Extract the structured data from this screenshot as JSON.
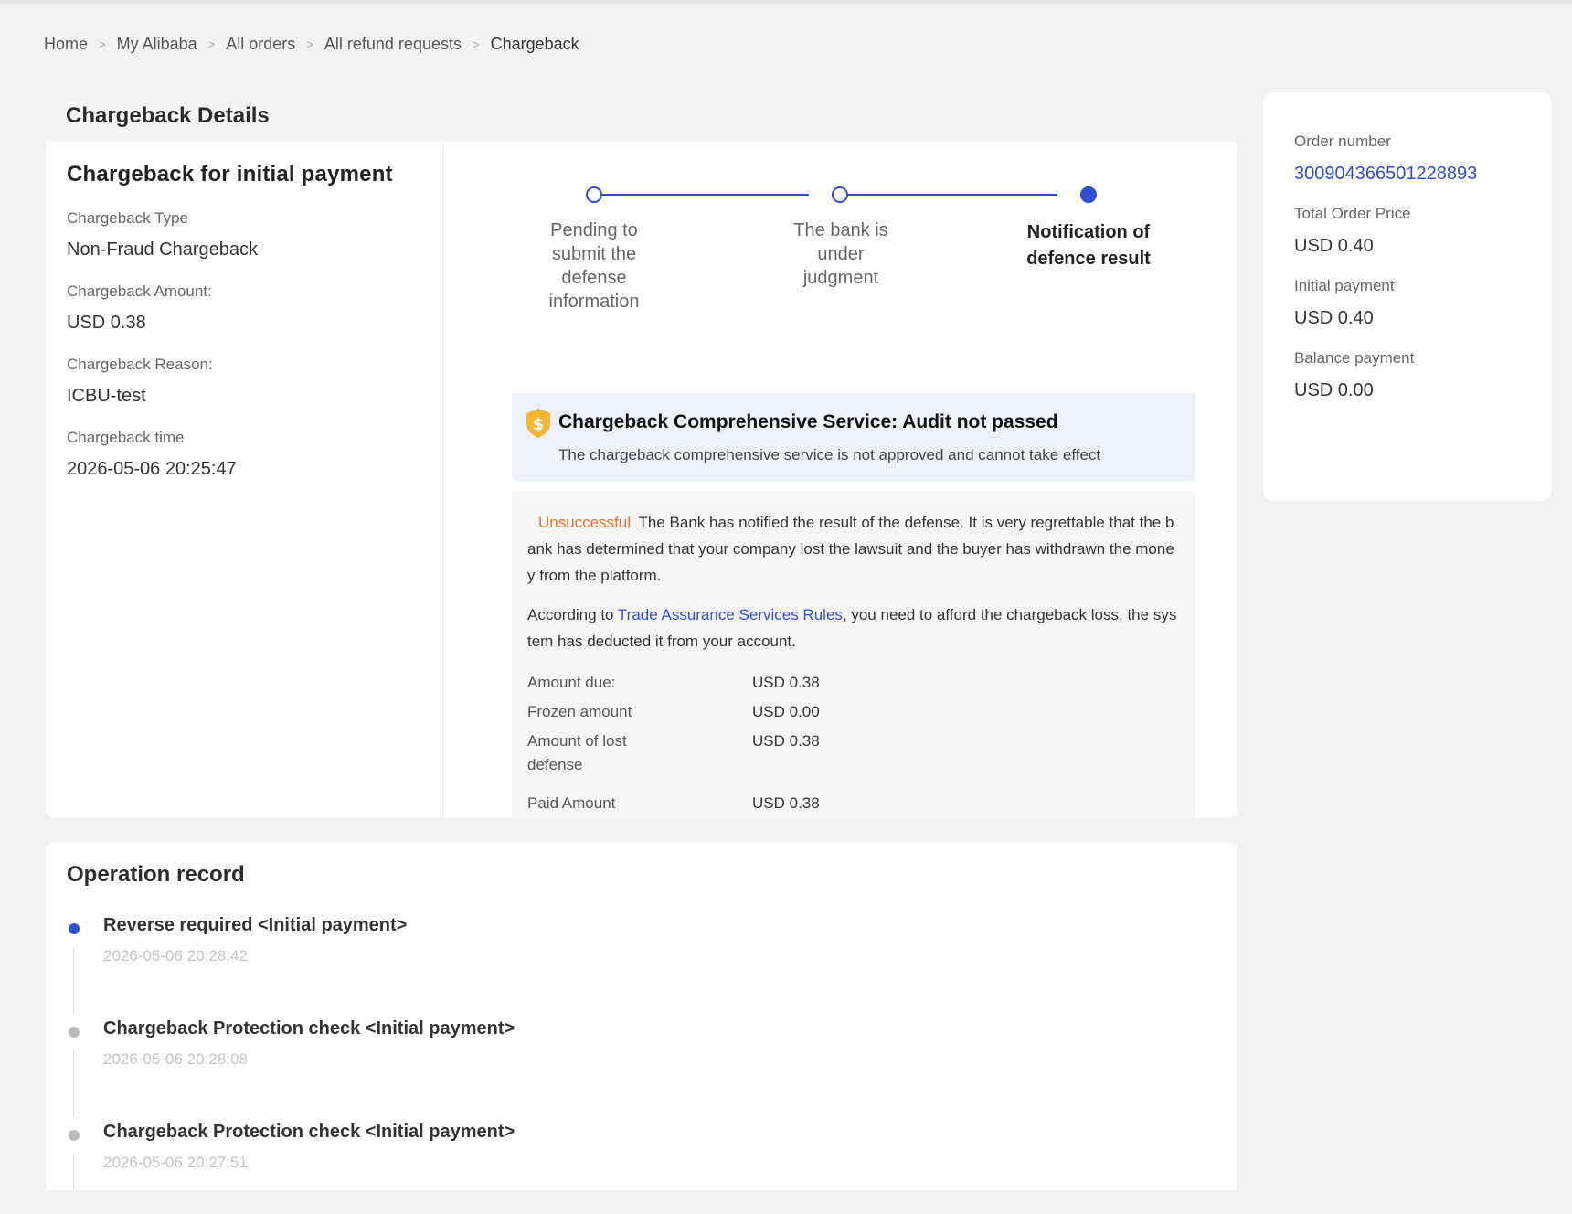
{
  "breadcrumb": {
    "items": [
      "Home",
      "My Alibaba",
      "All orders",
      "All refund requests",
      "Chargeback"
    ],
    "separator": ">"
  },
  "details": {
    "header": "Chargeback Details",
    "subtitle": "Chargeback for initial payment",
    "fields": [
      {
        "label": "Chargeback Type",
        "value": "Non-Fraud Chargeback"
      },
      {
        "label": "Chargeback Amount:",
        "value": "USD 0.38"
      },
      {
        "label": "Chargeback Reason:",
        "value": "ICBU-test"
      },
      {
        "label": "Chargeback time",
        "value": "2026-05-06 20:25:47"
      }
    ]
  },
  "stepper": {
    "steps": [
      {
        "label": "Pending to submit the defense information",
        "line1": "Pending to",
        "line2": "submit the",
        "line3": "defense",
        "line4": "information",
        "done": true,
        "active": false
      },
      {
        "label": "The bank is under judgment",
        "line1": "The bank is",
        "line2": "under",
        "line3": "judgment",
        "done": true,
        "active": false
      },
      {
        "label": "Notification of defence result",
        "line1": "Notification of",
        "line2": "defence result",
        "done": false,
        "active": true
      }
    ]
  },
  "service": {
    "title": "Chargeback Comprehensive Service:  Audit not passed",
    "description": "The chargeback comprehensive service is not approved and cannot take effect",
    "icon": "shield-dollar-icon"
  },
  "result": {
    "status": "Unsuccessful",
    "status_color": "#e8702a",
    "message": "The Bank has notified the result of the defense. It is very regrettable that the bank has determined that your company lost the lawsuit and the buyer has withdrawn the money from the platform.",
    "rules_prefix": "According to ",
    "rules_link": "Trade Assurance Services Rules",
    "rules_suffix": ", you need to afford the chargeback loss, the system has deducted it from your account.",
    "amounts": [
      {
        "label": "Amount due:",
        "value": "USD 0.38"
      },
      {
        "label": "Frozen amount",
        "value": "USD 0.00"
      },
      {
        "label": "Amount of lost defense",
        "value": "USD 0.38"
      },
      {
        "label": "Paid Amount",
        "value": "USD 0.38"
      }
    ]
  },
  "order": {
    "number_label": "Order number",
    "number": "300904366501228893",
    "total_label": "Total Order Price",
    "total": "USD 0.40",
    "initial_label": "Initial payment",
    "initial": "USD 0.40",
    "balance_label": "Balance payment",
    "balance": "USD 0.00"
  },
  "operation": {
    "title": "Operation record",
    "records": [
      {
        "title": "Reverse required  <Initial payment>",
        "time": "2026-05-06 20:28:42",
        "active": true
      },
      {
        "title": "Chargeback Protection check  <Initial payment>",
        "time": "2026-05-06 20:28:08",
        "active": false
      },
      {
        "title": "Chargeback Protection check  <Initial payment>",
        "time": "2026-05-06 20:27:51",
        "active": false
      }
    ]
  },
  "colors": {
    "accent": "#2f4fd3",
    "page_bg": "#f2f2f2",
    "banner_bg": "#eef1fb",
    "shield": "#f2b632"
  }
}
